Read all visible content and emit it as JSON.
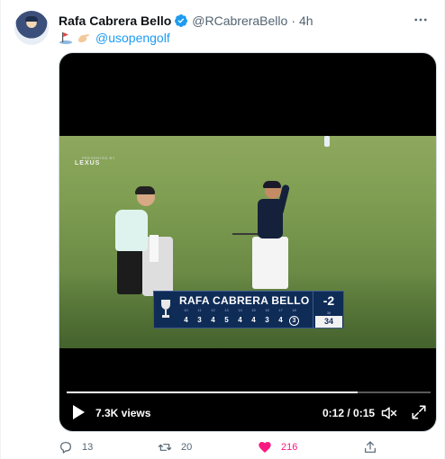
{
  "tweet": {
    "author_name": "Rafa Cabrera Bello",
    "handle": "@RCabreraBello",
    "separator": "·",
    "time": "4h",
    "mention": "@usopengolf",
    "more_icon": "more-icon"
  },
  "video": {
    "sponsor": "LEXUS",
    "sponsor_sub": "PRESENTED BY",
    "scoreboard": {
      "player": "RAFA CABRERA BELLO",
      "holes": [
        "10",
        "11",
        "12",
        "13",
        "14",
        "15",
        "16",
        "17",
        "18"
      ],
      "scores": [
        "4",
        "3",
        "4",
        "5",
        "4",
        "4",
        "3",
        "4",
        "3"
      ],
      "to_par": "-2",
      "round_hole": "36",
      "total": "34"
    },
    "views": "7.3K views",
    "time_display": "0:12 / 0:15",
    "progress": 0.8
  },
  "actions": {
    "replies": "13",
    "retweets": "20",
    "likes": "216"
  },
  "colors": {
    "accent": "#1d9bf0",
    "like": "#f91880",
    "muted": "#536471",
    "scoreboard": "#0f2c57"
  }
}
